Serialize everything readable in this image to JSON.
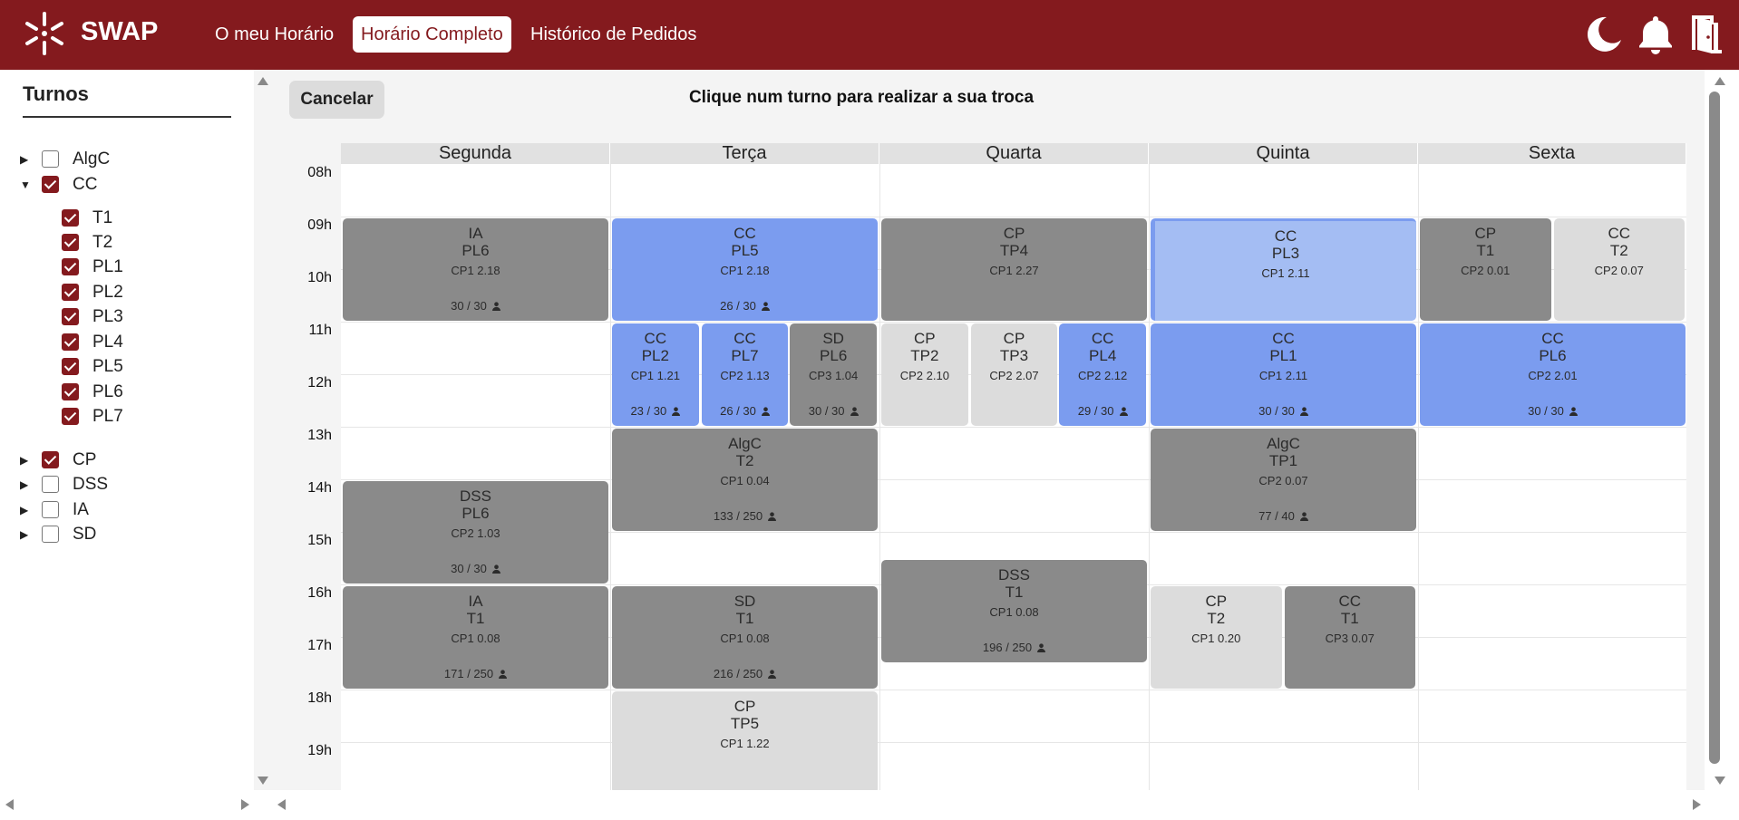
{
  "app": {
    "name": "SWAP"
  },
  "nav": {
    "links": [
      {
        "label": "O meu Horário",
        "active": false
      },
      {
        "label": "Horário Completo",
        "active": true
      },
      {
        "label": "Histórico de Pedidos",
        "active": false
      }
    ],
    "icons": [
      "moon-icon",
      "bell-icon",
      "logout-door-icon"
    ]
  },
  "colors": {
    "brand": "#841a1e",
    "shift_gray": "#8a8a8a",
    "shift_blue": "#7b9cef",
    "shift_light": "#dcdcdc",
    "shift_selected": "#a4bdf3"
  },
  "sidebar": {
    "title": "Turnos",
    "courses": [
      {
        "name": "AlgC",
        "checked": false,
        "expanded": false
      },
      {
        "name": "CC",
        "checked": true,
        "expanded": true,
        "shifts": [
          {
            "name": "T1",
            "checked": true
          },
          {
            "name": "T2",
            "checked": true
          },
          {
            "name": "PL1",
            "checked": true
          },
          {
            "name": "PL2",
            "checked": true
          },
          {
            "name": "PL3",
            "checked": true
          },
          {
            "name": "PL4",
            "checked": true
          },
          {
            "name": "PL5",
            "checked": true
          },
          {
            "name": "PL6",
            "checked": true
          },
          {
            "name": "PL7",
            "checked": true
          }
        ]
      },
      {
        "name": "CP",
        "checked": true,
        "expanded": false
      },
      {
        "name": "DSS",
        "checked": false,
        "expanded": false
      },
      {
        "name": "IA",
        "checked": false,
        "expanded": false
      },
      {
        "name": "SD",
        "checked": false,
        "expanded": false
      }
    ]
  },
  "main": {
    "cancel_label": "Cancelar",
    "instruction": "Clique num turno para realizar a sua troca"
  },
  "schedule": {
    "days": [
      "Segunda",
      "Terça",
      "Quarta",
      "Quinta",
      "Sexta"
    ],
    "hours": [
      "08h",
      "09h",
      "10h",
      "11h",
      "12h",
      "13h",
      "14h",
      "15h",
      "16h",
      "17h",
      "18h",
      "19h"
    ],
    "shifts": [
      {
        "day": 0,
        "start": 9,
        "end": 11,
        "lane": 0,
        "lanes": 1,
        "uc": "IA",
        "type": "PL6",
        "room": "CP1 2.18",
        "capacity": "30 / 30",
        "color": "gray"
      },
      {
        "day": 1,
        "start": 9,
        "end": 11,
        "lane": 0,
        "lanes": 1,
        "uc": "CC",
        "type": "PL5",
        "room": "CP1 2.18",
        "capacity": "26 / 30",
        "color": "blue"
      },
      {
        "day": 2,
        "start": 9,
        "end": 11,
        "lane": 0,
        "lanes": 1,
        "uc": "CP",
        "type": "TP4",
        "room": "CP1 2.27",
        "capacity": "",
        "color": "gray"
      },
      {
        "day": 3,
        "start": 9,
        "end": 11,
        "lane": 0,
        "lanes": 1,
        "uc": "CC",
        "type": "PL3",
        "room": "CP1 2.11",
        "capacity": "",
        "color": "pale"
      },
      {
        "day": 4,
        "start": 9,
        "end": 11,
        "lane": 0,
        "lanes": 2,
        "uc": "CP",
        "type": "T1",
        "room": "CP2 0.01",
        "capacity": "",
        "color": "gray"
      },
      {
        "day": 4,
        "start": 9,
        "end": 11,
        "lane": 1,
        "lanes": 2,
        "uc": "CC",
        "type": "T2",
        "room": "CP2 0.07",
        "capacity": "",
        "color": "light"
      },
      {
        "day": 1,
        "start": 11,
        "end": 13,
        "lane": 0,
        "lanes": 3,
        "uc": "CC",
        "type": "PL2",
        "room": "CP1 1.21",
        "capacity": "23 / 30",
        "color": "blue"
      },
      {
        "day": 1,
        "start": 11,
        "end": 13,
        "lane": 1,
        "lanes": 3,
        "uc": "CC",
        "type": "PL7",
        "room": "CP2 1.13",
        "capacity": "26 / 30",
        "color": "blue"
      },
      {
        "day": 1,
        "start": 11,
        "end": 13,
        "lane": 2,
        "lanes": 3,
        "uc": "SD",
        "type": "PL6",
        "room": "CP3 1.04",
        "capacity": "30 / 30",
        "color": "gray"
      },
      {
        "day": 2,
        "start": 11,
        "end": 13,
        "lane": 0,
        "lanes": 3,
        "uc": "CP",
        "type": "TP2",
        "room": "CP2 2.10",
        "capacity": "",
        "color": "light"
      },
      {
        "day": 2,
        "start": 11,
        "end": 13,
        "lane": 1,
        "lanes": 3,
        "uc": "CP",
        "type": "TP3",
        "room": "CP2 2.07",
        "capacity": "",
        "color": "light"
      },
      {
        "day": 2,
        "start": 11,
        "end": 13,
        "lane": 2,
        "lanes": 3,
        "uc": "CC",
        "type": "PL4",
        "room": "CP2 2.12",
        "capacity": "29 / 30",
        "color": "blue"
      },
      {
        "day": 3,
        "start": 11,
        "end": 13,
        "lane": 0,
        "lanes": 1,
        "uc": "CC",
        "type": "PL1",
        "room": "CP1 2.11",
        "capacity": "30 / 30",
        "color": "blue"
      },
      {
        "day": 4,
        "start": 11,
        "end": 13,
        "lane": 0,
        "lanes": 1,
        "uc": "CC",
        "type": "PL6",
        "room": "CP2 2.01",
        "capacity": "30 / 30",
        "color": "blue"
      },
      {
        "day": 1,
        "start": 13,
        "end": 15,
        "lane": 0,
        "lanes": 1,
        "uc": "AlgC",
        "type": "T2",
        "room": "CP1 0.04",
        "capacity": "133 / 250",
        "color": "gray"
      },
      {
        "day": 3,
        "start": 13,
        "end": 15,
        "lane": 0,
        "lanes": 1,
        "uc": "AlgC",
        "type": "TP1",
        "room": "CP2 0.07",
        "capacity": "77 / 40",
        "color": "gray"
      },
      {
        "day": 0,
        "start": 14,
        "end": 16,
        "lane": 0,
        "lanes": 1,
        "uc": "DSS",
        "type": "PL6",
        "room": "CP2 1.03",
        "capacity": "30 / 30",
        "color": "gray"
      },
      {
        "day": 2,
        "start": 15.5,
        "end": 17.5,
        "lane": 0,
        "lanes": 1,
        "uc": "DSS",
        "type": "T1",
        "room": "CP1 0.08",
        "capacity": "196 / 250",
        "color": "gray"
      },
      {
        "day": 0,
        "start": 16,
        "end": 18,
        "lane": 0,
        "lanes": 1,
        "uc": "IA",
        "type": "T1",
        "room": "CP1 0.08",
        "capacity": "171 / 250",
        "color": "gray"
      },
      {
        "day": 1,
        "start": 16,
        "end": 18,
        "lane": 0,
        "lanes": 1,
        "uc": "SD",
        "type": "T1",
        "room": "CP1 0.08",
        "capacity": "216 / 250",
        "color": "gray"
      },
      {
        "day": 3,
        "start": 16,
        "end": 18,
        "lane": 0,
        "lanes": 2,
        "uc": "CP",
        "type": "T2",
        "room": "CP1 0.20",
        "capacity": "",
        "color": "light"
      },
      {
        "day": 3,
        "start": 16,
        "end": 18,
        "lane": 1,
        "lanes": 2,
        "uc": "CC",
        "type": "T1",
        "room": "CP3 0.07",
        "capacity": "",
        "color": "gray"
      },
      {
        "day": 1,
        "start": 18,
        "end": 20,
        "lane": 0,
        "lanes": 1,
        "uc": "CP",
        "type": "TP5",
        "room": "CP1 1.22",
        "capacity": "",
        "color": "light"
      }
    ]
  }
}
